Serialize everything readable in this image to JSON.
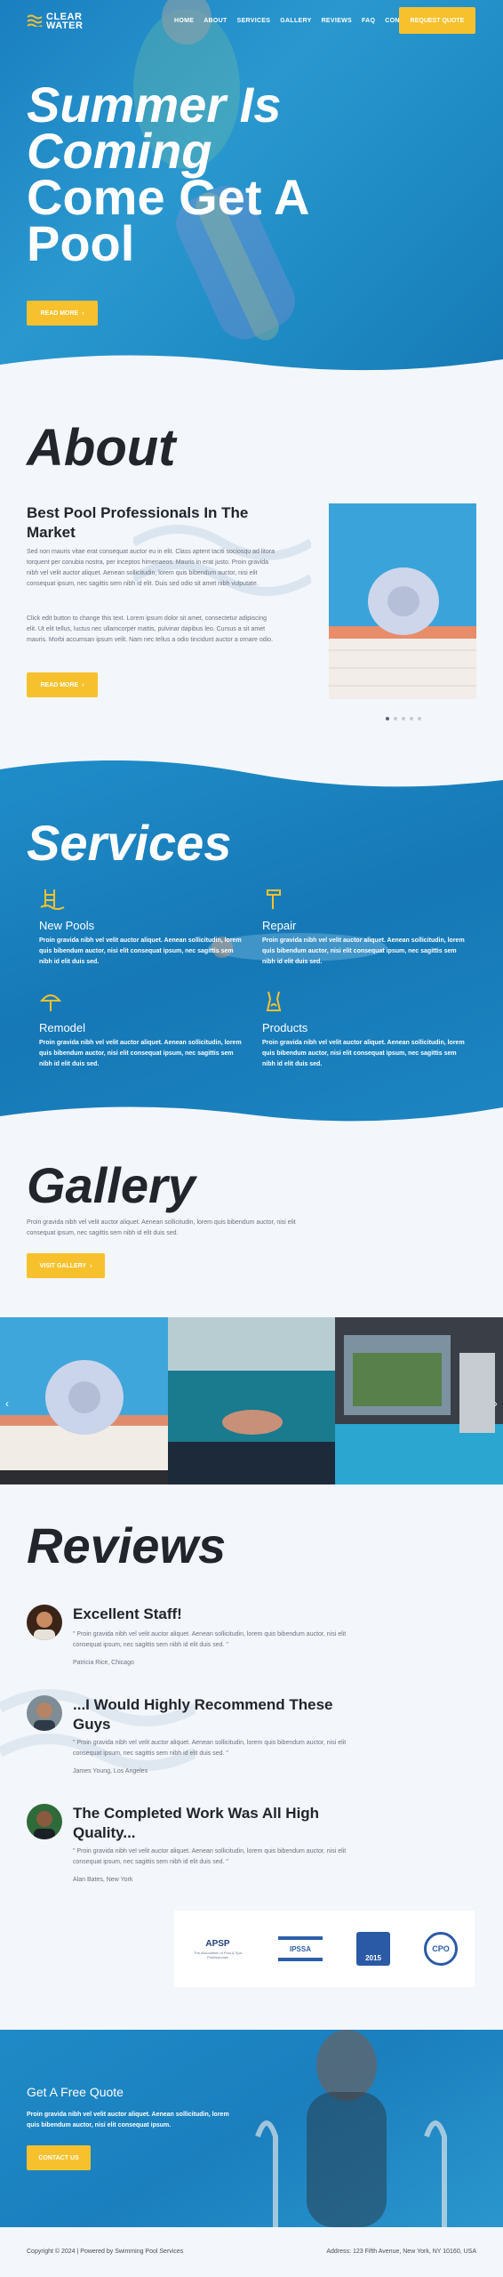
{
  "brand": {
    "logo_text": "CLEAR WATER"
  },
  "nav": {
    "items": [
      "HOME",
      "ABOUT",
      "SERVICES",
      "GALLERY",
      "REVIEWS",
      "FAQ",
      "CONTACT"
    ],
    "cta": "REQUEST QUOTE"
  },
  "hero": {
    "title_line1": "Summer Is",
    "title_line2": "Coming",
    "title_line3": "Come Get A",
    "title_line4": "Pool",
    "button": "READ MORE"
  },
  "about": {
    "title": "About",
    "subtitle": "Best Pool Professionals In The Market",
    "p1": "Sed non mauris vitae erat consequat auctor eu in elit. Class aptent taciti sociosqu ad litora torquent per conubia nostra, per inceptos himenaeos. Mauris in erat justo. Proin gravida nibh vel velit auctor aliquet. Aenean sollicitudin, lorem quis bibendum auctor, nisi elit consequat ipsum, nec sagittis sem nibh id elit. Duis sed odio sit amet nibh vulputate.",
    "p2": "Click edit button to change this text. Lorem ipsum dolor sit amet, consectetur adipiscing elit. Ut elit tellus, luctus nec ullamcorper mattis, pulvinar dapibus leo. Cursus a sit amet mauris. Morbi accumsan ipsum velit. Nam nec tellus a odio tincidunt auctor a ornare odio.",
    "button": "READ MORE"
  },
  "services": {
    "title": "Services",
    "items": [
      {
        "name": "New Pools",
        "desc": "Proin gravida nibh vel velit auctor aliquet. Aenean sollicitudin, lorem quis bibendum auctor, nisi elit consequat ipsum, nec sagittis sem nibh id elit duis sed."
      },
      {
        "name": "Repair",
        "desc": "Proin gravida nibh vel velit auctor aliquet. Aenean sollicitudin, lorem quis bibendum auctor, nisi elit consequat ipsum, nec sagittis sem nibh id elit duis sed."
      },
      {
        "name": "Remodel",
        "desc": "Proin gravida nibh vel velit auctor aliquet. Aenean sollicitudin, lorem quis bibendum auctor, nisi elit consequat ipsum, nec sagittis sem nibh id elit duis sed."
      },
      {
        "name": "Products",
        "desc": "Proin gravida nibh vel velit auctor aliquet. Aenean sollicitudin, lorem quis bibendum auctor, nisi elit consequat ipsum, nec sagittis sem nibh id elit duis sed."
      }
    ]
  },
  "gallery": {
    "title": "Gallery",
    "desc": "Proin gravida nibh vel velit auctor aliquet. Aenean sollicitudin, lorem quis bibendum auctor, nisi elit consequat ipsum, nec sagittis sem nibh id elit duis sed.",
    "button": "VISIT GALLERY"
  },
  "reviews": {
    "title": "Reviews",
    "items": [
      {
        "heading": "Excellent Staff!",
        "body": "\" Proin gravida nibh vel velit auctor aliquet. Aenean sollicitudin, lorem quis bibendum auctor, nisi elit consequat ipsum, nec sagittis sem nibh id elit duis sed. \"",
        "author": "Patricia Rice, Chicago"
      },
      {
        "heading": "...I Would Highly Recommend These Guys",
        "body": "\" Proin gravida nibh vel velit auctor aliquet. Aenean sollicitudin, lorem quis bibendum auctor, nisi elit consequat ipsum, nec sagittis sem nibh id elit duis sed. \"",
        "author": "James Young, Los Angeles"
      },
      {
        "heading": "The Completed Work Was All High Quality...",
        "body": "\" Proin gravida nibh vel velit auctor aliquet. Aenean sollicitudin, lorem quis bibendum auctor, nisi elit consequat ipsum, nec sagittis sem nibh id elit duis sed. \"",
        "author": "Alan Bates, New York"
      }
    ]
  },
  "logos": {
    "apsp": "APSP",
    "apsp_sub": "The Association of Pool & Spa Professionals",
    "ipssa": "IPSSA",
    "year": "2015",
    "cpo": "CPO"
  },
  "cta": {
    "title": "Get A Free Quote",
    "desc": "Proin gravida nibh vel velit auctor aliquet. Aenean sollicitudin, lorem quis bibendum auctor, nisi elit consequat ipsum.",
    "button": "CONTACT US"
  },
  "footer": {
    "copyright": "Copyright © 2024 | Powered by Swimming Pool Services",
    "address": "Address: 123 Fifth Avenue, New York, NY 10160, USA"
  },
  "colors": {
    "accent": "#f7c12e",
    "water": "#1e8ac6",
    "dark": "#22252c"
  }
}
